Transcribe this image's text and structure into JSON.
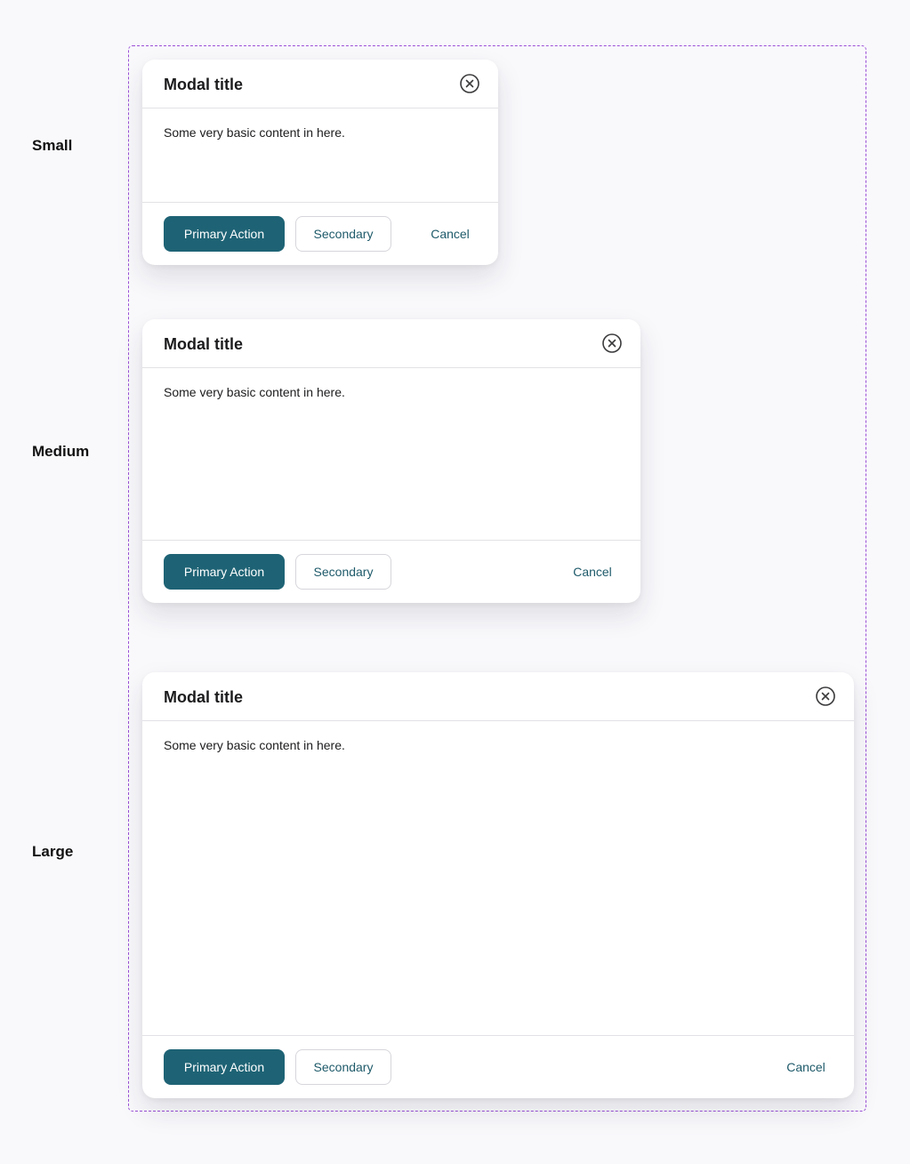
{
  "sizes": [
    {
      "label": "Small",
      "modal": {
        "title": "Modal title",
        "body": "Some very basic content in here.",
        "primary_label": "Primary Action",
        "secondary_label": "Secondary",
        "cancel_label": "Cancel",
        "close_icon": "close-circle-icon"
      }
    },
    {
      "label": "Medium",
      "modal": {
        "title": "Modal title",
        "body": "Some very basic content in here.",
        "primary_label": "Primary Action",
        "secondary_label": "Secondary",
        "cancel_label": "Cancel",
        "close_icon": "close-circle-icon"
      }
    },
    {
      "label": "Large",
      "modal": {
        "title": "Modal title",
        "body": "Some very basic content in here.",
        "primary_label": "Primary Action",
        "secondary_label": "Secondary",
        "cancel_label": "Cancel",
        "close_icon": "close-circle-icon"
      }
    }
  ],
  "colors": {
    "primary": "#1e6375",
    "link": "#1e5a6a",
    "frame_border": "#9b4fd6",
    "background": "#f9f9fc"
  }
}
